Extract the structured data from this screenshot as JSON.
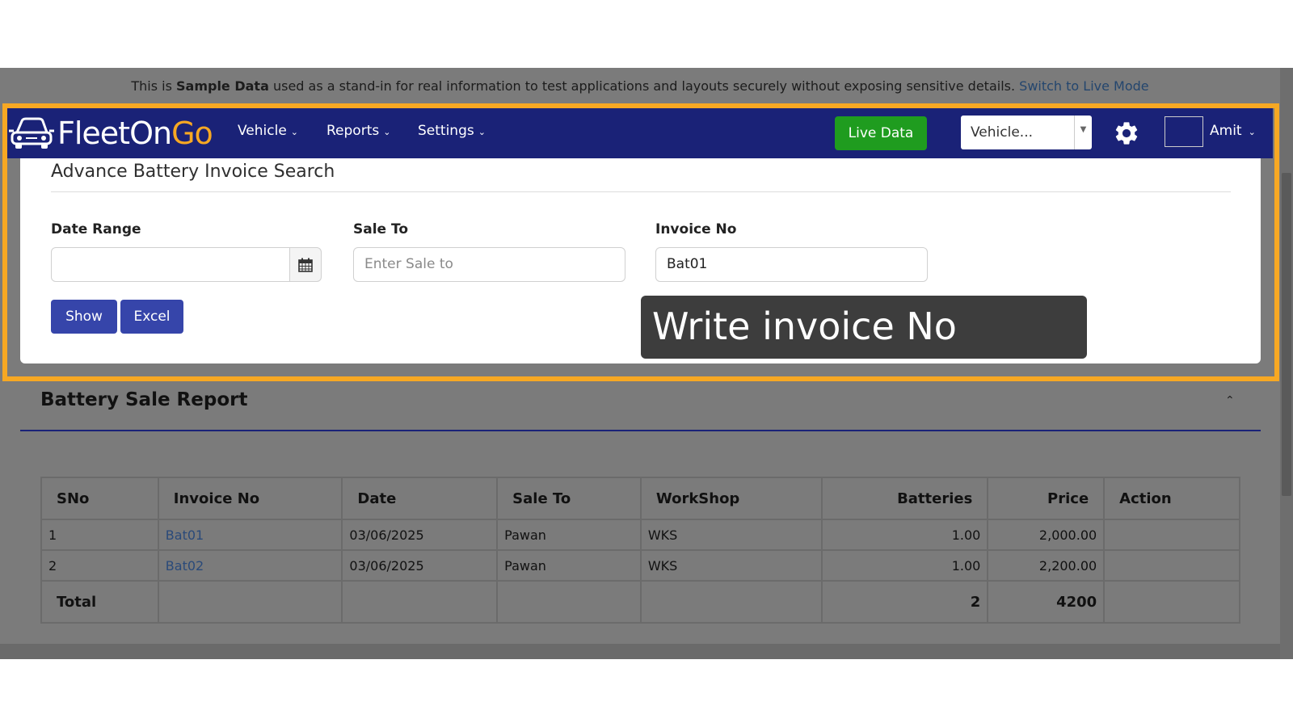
{
  "banner": {
    "prefix": "This is ",
    "bold": "Sample Data",
    "middle": " used as a stand-in for real information to test applications and layouts securely without exposing sensitive details. ",
    "link": "Switch to Live Mode"
  },
  "navbar": {
    "logo": {
      "part1": "FleetOn",
      "part2": "Go"
    },
    "menu": [
      "Vehicle",
      "Reports",
      "Settings"
    ],
    "live_data_label": "Live Data",
    "vehicle_select_value": "Vehicle...",
    "user_name": "Amit"
  },
  "search": {
    "title": "Advance Battery Invoice Search",
    "fields": {
      "date_range": {
        "label": "Date Range",
        "value": ""
      },
      "sale_to": {
        "label": "Sale To",
        "placeholder": "Enter Sale to"
      },
      "invoice_no": {
        "label": "Invoice No",
        "value": "Bat01"
      }
    },
    "buttons": {
      "show": "Show",
      "excel": "Excel"
    }
  },
  "tooltip": "Write invoice No",
  "report": {
    "title": "Battery Sale Report",
    "columns": [
      "SNo",
      "Invoice No",
      "Date",
      "Sale To",
      "WorkShop",
      "Batteries",
      "Price",
      "Action"
    ],
    "rows": [
      {
        "sno": "1",
        "invoice": "Bat01",
        "date": "03/06/2025",
        "sale_to": "Pawan",
        "workshop": "WKS",
        "batteries": "1.00",
        "price": "2,000.00",
        "action": ""
      },
      {
        "sno": "2",
        "invoice": "Bat02",
        "date": "03/06/2025",
        "sale_to": "Pawan",
        "workshop": "WKS",
        "batteries": "1.00",
        "price": "2,200.00",
        "action": ""
      }
    ],
    "total": {
      "label": "Total",
      "batteries": "2",
      "price": "4200"
    }
  },
  "colors": {
    "navbar": "#1a2277",
    "highlight": "#f7a823",
    "live_button": "#1f9c1f",
    "primary_button": "#3645aa",
    "overlay": "#7b7b7b"
  }
}
